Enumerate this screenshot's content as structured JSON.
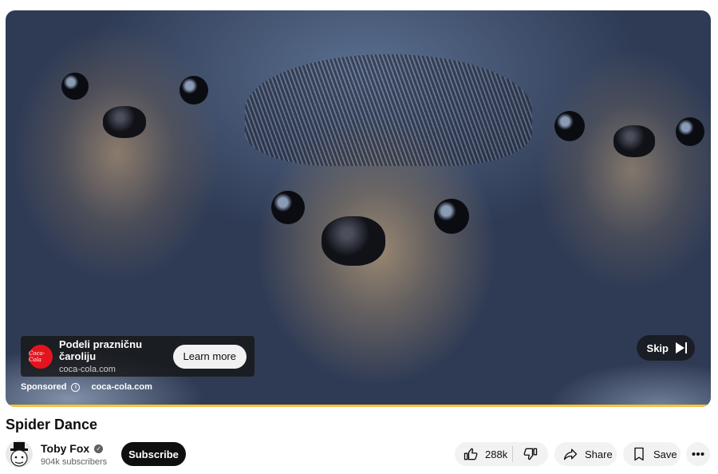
{
  "ad": {
    "title": "Podeli prazničnu čaroliju",
    "domain": "coca-cola.com",
    "logo_text": "Coca-Cola",
    "cta_label": "Learn more",
    "sponsored_label": "Sponsored",
    "sponsored_domain": "coca-cola.com",
    "skip_label": "Skip",
    "brand_color": "#e4141e"
  },
  "player": {
    "progress_color": "#f6c33a"
  },
  "video": {
    "title": "Spider Dance",
    "channel_name": "Toby Fox",
    "subscribers": "904k subscribers",
    "subscribe_label": "Subscribe"
  },
  "actions": {
    "likes": "288k",
    "share_label": "Share",
    "save_label": "Save"
  },
  "icons": [
    "coca-cola-logo-icon",
    "info-icon",
    "skip-icon",
    "verified-icon",
    "thumbs-up-icon",
    "thumbs-down-icon",
    "share-icon",
    "save-icon",
    "more-icon"
  ]
}
